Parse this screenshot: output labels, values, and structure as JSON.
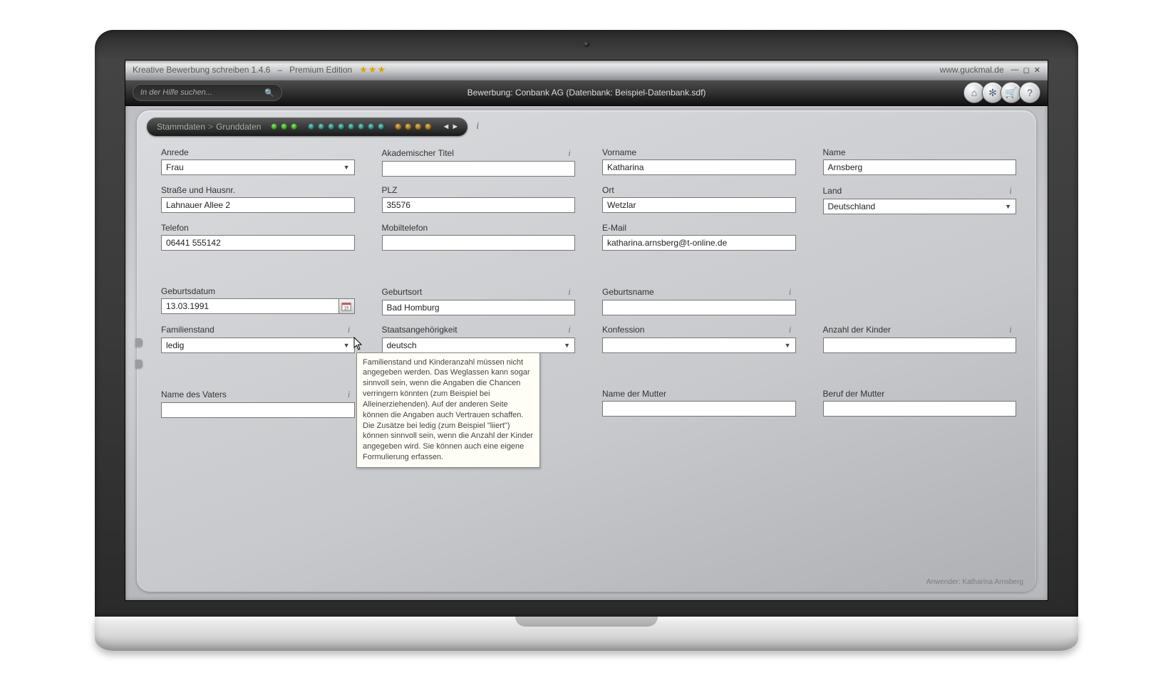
{
  "titlebar": {
    "app_title": "Kreative Bewerbung schreiben 1.4.6",
    "edition_sep": "–",
    "edition": "Premium Edition",
    "website": "www.guckmal.de"
  },
  "topbar": {
    "search_placeholder": "In der Hilfe suchen...",
    "center_text": "Bewerbung: Conbank AG (Datenbank: Beispiel-Datenbank.sdf)"
  },
  "breadcrumb": {
    "root": "Stammdaten",
    "sep": ">",
    "current": "Grunddaten"
  },
  "fields": {
    "anrede": {
      "label": "Anrede",
      "value": "Frau"
    },
    "titel": {
      "label": "Akademischer Titel",
      "value": ""
    },
    "vorname": {
      "label": "Vorname",
      "value": "Katharina"
    },
    "name": {
      "label": "Name",
      "value": "Arnsberg"
    },
    "strasse": {
      "label": "Straße und Hausnr.",
      "value": "Lahnauer Allee 2"
    },
    "plz": {
      "label": "PLZ",
      "value": "35576"
    },
    "ort": {
      "label": "Ort",
      "value": "Wetzlar"
    },
    "land": {
      "label": "Land",
      "value": "Deutschland"
    },
    "telefon": {
      "label": "Telefon",
      "value": "06441 555142"
    },
    "mobil": {
      "label": "Mobiltelefon",
      "value": ""
    },
    "email": {
      "label": "E-Mail",
      "value": "katharina.arnsberg@t-online.de"
    },
    "gebdatum": {
      "label": "Geburtsdatum",
      "value": "13.03.1991"
    },
    "gebort": {
      "label": "Geburtsort",
      "value": "Bad Homburg"
    },
    "gebname": {
      "label": "Geburtsname",
      "value": ""
    },
    "famstand": {
      "label": "Familienstand",
      "value": "ledig"
    },
    "staat": {
      "label": "Staatsangehörigkeit",
      "value": "deutsch"
    },
    "konfession": {
      "label": "Konfession",
      "value": ""
    },
    "kinder": {
      "label": "Anzahl der Kinder",
      "value": ""
    },
    "vater_name": {
      "label": "Name des Vaters",
      "value": ""
    },
    "vater_beruf_hidden": {
      "label": "",
      "value": ""
    },
    "mutter_name": {
      "label": "Name der Mutter",
      "value": ""
    },
    "mutter_beruf": {
      "label": "Beruf der Mutter",
      "value": ""
    }
  },
  "tooltip": {
    "text": "Familienstand und Kinderanzahl müssen nicht angegeben werden. Das Weglassen kann sogar sinnvoll sein, wenn die Angaben die Chancen verringern könnten (zum Beispiel bei Alleinerziehenden). Auf der anderen Seite können die Angaben auch Vertrauen schaffen. Die Zusätze bei ledig (zum Beispiel \"liiert\") können sinnvoll sein, wenn die Anzahl der Kinder angegeben wird. Sie können auch eine eigene Formulierung erfassen."
  },
  "footer": {
    "user_label": "Anwender: Katharina Arnsberg"
  }
}
